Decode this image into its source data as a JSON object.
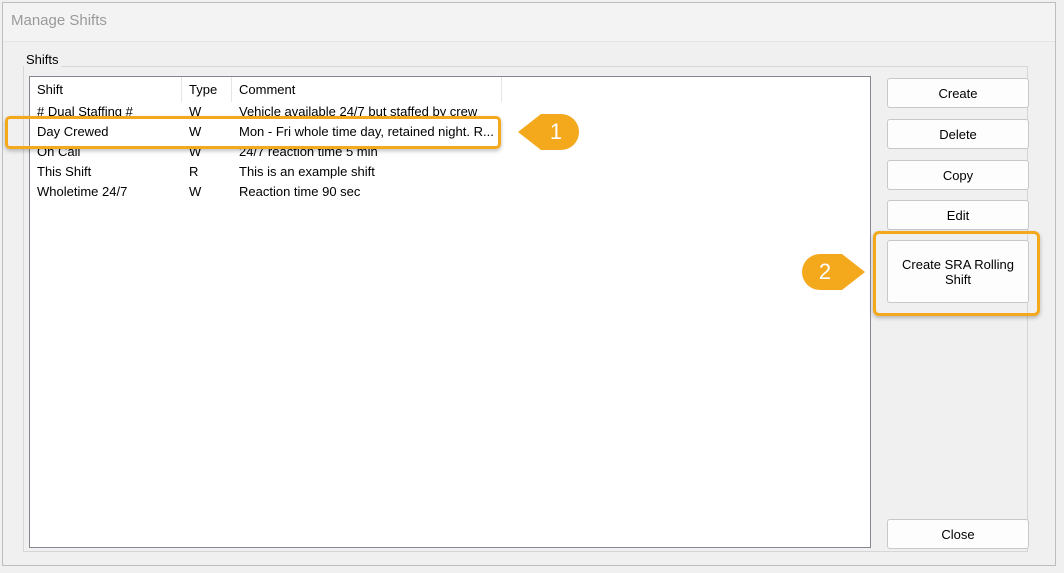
{
  "window": {
    "title": "Manage Shifts"
  },
  "group": {
    "label": "Shifts"
  },
  "list": {
    "columns": [
      "Shift",
      "Type",
      "Comment"
    ],
    "rows": [
      [
        "# Dual Staffing #",
        "W",
        "Vehicle available 24/7 but staffed by crew"
      ],
      [
        "Day Crewed",
        "W",
        "Mon - Fri whole time day, retained night. R..."
      ],
      [
        "On Call",
        "W",
        "24/7 reaction time 5 min"
      ],
      [
        "This Shift",
        "R",
        "This is an example shift"
      ],
      [
        "Wholetime 24/7",
        "W",
        "Reaction time 90 sec"
      ]
    ],
    "selected_row": "Day Crewed"
  },
  "buttons": {
    "create": "Create",
    "delete": "Delete",
    "copy": "Copy",
    "edit": "Edit",
    "create_sra": "Create SRA Rolling Shift",
    "close": "Close"
  },
  "callouts": {
    "one": "1",
    "two": "2"
  },
  "colors": {
    "highlight": "#f4a81c",
    "callout": "#f4a81c"
  }
}
